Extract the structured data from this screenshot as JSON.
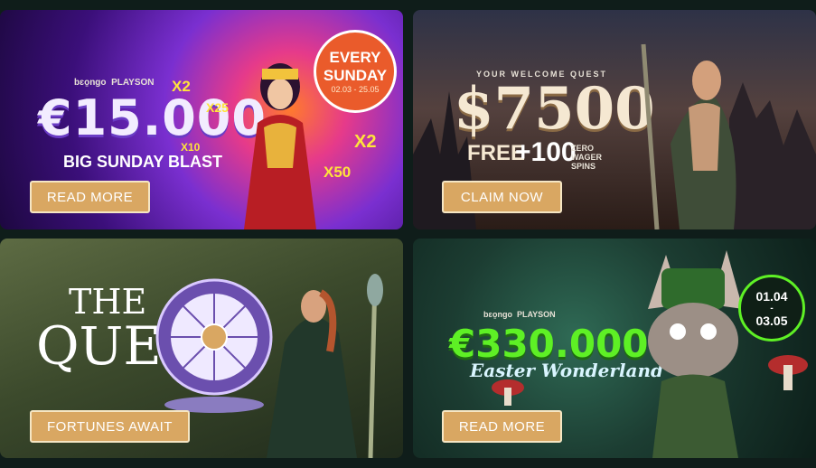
{
  "promo1": {
    "providers": [
      "bɛo̱ngo",
      "PLAYSON"
    ],
    "amount": "€15.000",
    "title": "BIG SUNDAY BLAST",
    "badge_line1": "EVERY",
    "badge_line2": "SUNDAY",
    "badge_dates": "02.03 - 25.05",
    "multipliers": [
      "X2",
      "X25",
      "X10",
      "X2",
      "X50"
    ],
    "cta": "READ MORE",
    "colors": {
      "badge": "#ea5b2b",
      "button": "#d9a762"
    }
  },
  "promo2": {
    "eyebrow": "YOUR WELCOME QUEST",
    "amount": "$7500",
    "line1": "FREE",
    "line2": "+100",
    "line3": "ZERO WAGER SPINS",
    "cta": "CLAIM NOW"
  },
  "promo3": {
    "title1": "THE",
    "title2": "QUEST",
    "cta": "FORTUNES AWAIT"
  },
  "promo4": {
    "providers": [
      "bɛo̱ngo",
      "PLAYSON"
    ],
    "amount": "€330.000",
    "title": "Easter Wonderland",
    "date1": "01.04",
    "date2": "03.05",
    "cta": "READ MORE",
    "colors": {
      "amount": "#5ef025"
    }
  }
}
